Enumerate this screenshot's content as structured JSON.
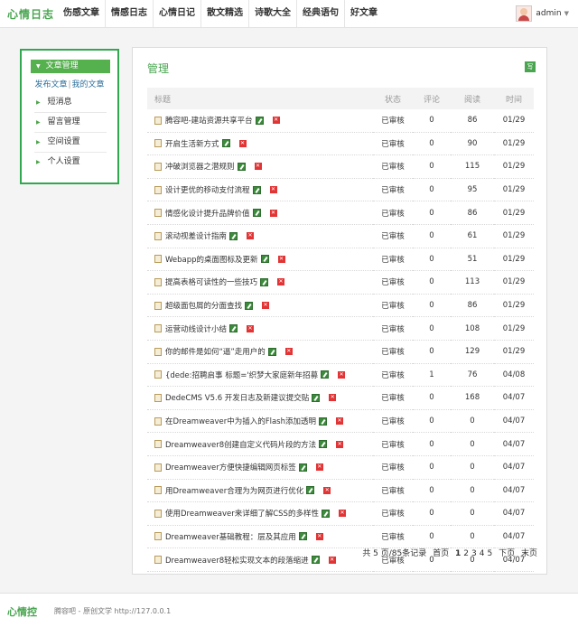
{
  "header": {
    "logo": "心情日志",
    "nav": [
      "伤感文章",
      "情感日志",
      "心情日记",
      "散文精选",
      "诗歌大全",
      "经典语句",
      "好文章"
    ],
    "user": "admin"
  },
  "sidebar": {
    "section": "文章管理",
    "links": [
      "发布文章",
      "我的文章"
    ],
    "items": [
      "短消息",
      "留言管理",
      "空间设置",
      "个人设置"
    ]
  },
  "main": {
    "title": "管理",
    "write_label": "写",
    "columns": {
      "title": "标题",
      "status": "状态",
      "comments": "评论",
      "reads": "阅读",
      "time": "时间"
    },
    "rows": [
      {
        "title": "腾容吧-建站资源共享平台",
        "status": "已审核",
        "comments": "0",
        "reads": "86",
        "time": "01/29"
      },
      {
        "title": "开启生活新方式",
        "status": "已审核",
        "comments": "0",
        "reads": "90",
        "time": "01/29"
      },
      {
        "title": "冲破浏览器之潜规则",
        "status": "已审核",
        "comments": "0",
        "reads": "115",
        "time": "01/29"
      },
      {
        "title": "设计更优的移动支付流程",
        "status": "已审核",
        "comments": "0",
        "reads": "95",
        "time": "01/29"
      },
      {
        "title": "情感化设计提升品牌价值",
        "status": "已审核",
        "comments": "0",
        "reads": "86",
        "time": "01/29"
      },
      {
        "title": "滚动视差设计指南",
        "status": "已审核",
        "comments": "0",
        "reads": "61",
        "time": "01/29"
      },
      {
        "title": "Webapp的桌面图标及更新",
        "status": "已审核",
        "comments": "0",
        "reads": "51",
        "time": "01/29"
      },
      {
        "title": "提高表格可读性的一些技巧",
        "status": "已审核",
        "comments": "0",
        "reads": "113",
        "time": "01/29"
      },
      {
        "title": "超级面包屑的分面查找",
        "status": "已审核",
        "comments": "0",
        "reads": "86",
        "time": "01/29"
      },
      {
        "title": "运营动线设计小结",
        "status": "已审核",
        "comments": "0",
        "reads": "108",
        "time": "01/29"
      },
      {
        "title": "你的邮件是如何“逼”走用户的",
        "status": "已审核",
        "comments": "0",
        "reads": "129",
        "time": "01/29"
      },
      {
        "title": "{dede:招聘启事 标题='织梦大家庭新年招募",
        "status": "已审核",
        "comments": "1",
        "reads": "76",
        "time": "04/08"
      },
      {
        "title": "DedeCMS V5.6 开发日志及新建议提交贴",
        "status": "已审核",
        "comments": "0",
        "reads": "168",
        "time": "04/07"
      },
      {
        "title": "在Dreamweaver中为插入的Flash添加透明",
        "status": "已审核",
        "comments": "0",
        "reads": "0",
        "time": "04/07"
      },
      {
        "title": "Dreamweaver8创建自定义代码片段的方法",
        "status": "已审核",
        "comments": "0",
        "reads": "0",
        "time": "04/07"
      },
      {
        "title": "Dreamweaver方便快捷编辑网页标签",
        "status": "已审核",
        "comments": "0",
        "reads": "0",
        "time": "04/07"
      },
      {
        "title": "用Dreamweaver合理为为网页进行优化",
        "status": "已审核",
        "comments": "0",
        "reads": "0",
        "time": "04/07"
      },
      {
        "title": "使用Dreamweaver来详细了解CSS的多样性",
        "status": "已审核",
        "comments": "0",
        "reads": "0",
        "time": "04/07"
      },
      {
        "title": "Dreamweaver基础教程：层及其应用",
        "status": "已审核",
        "comments": "0",
        "reads": "0",
        "time": "04/07"
      },
      {
        "title": "Dreamweaver8轻松实现文本的段落缩进",
        "status": "已审核",
        "comments": "0",
        "reads": "0",
        "time": "04/07"
      }
    ]
  },
  "pager": {
    "summary": "共 5 页/85条记录",
    "first": "首页",
    "pages": [
      "1",
      "2",
      "3",
      "4",
      "5"
    ],
    "next": "下页",
    "last": "末页"
  },
  "footer": {
    "logo": "心情控",
    "text": "腾容吧 - 原创文学 http://127.0.0.1"
  }
}
